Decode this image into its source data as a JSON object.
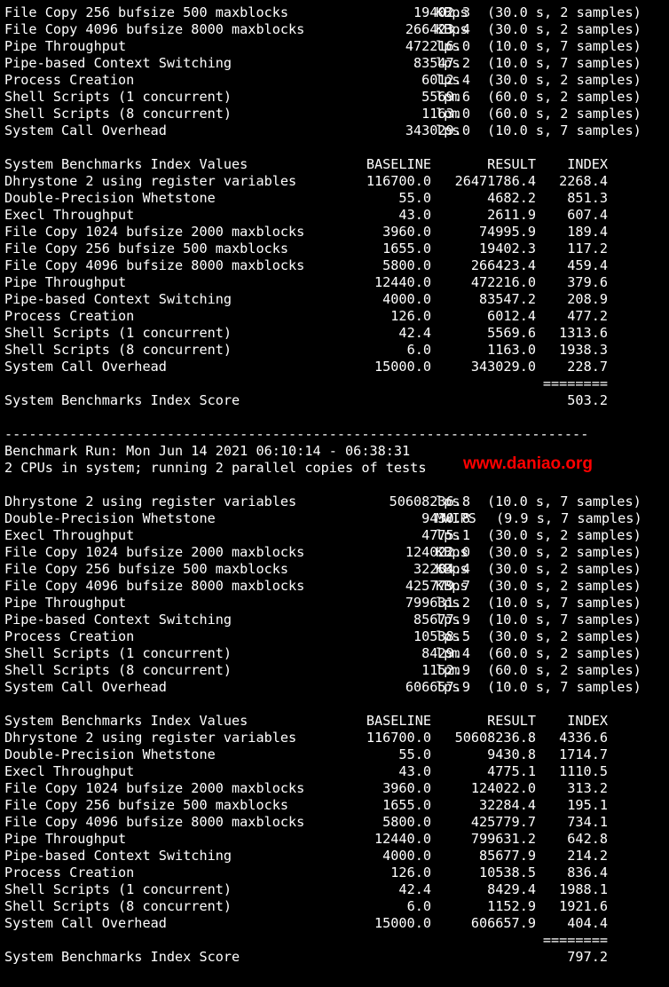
{
  "colors": {
    "background": "#000000",
    "text": "#ffffff",
    "watermark": "#ff0000"
  },
  "watermark": "www.daniao.org",
  "top_results": [
    {
      "name": "File Copy 256 bufsize 500 maxblocks",
      "value": "19402.3",
      "unit": "KBps",
      "detail": "(30.0 s, 2 samples)"
    },
    {
      "name": "File Copy 4096 bufsize 8000 maxblocks",
      "value": "266423.4",
      "unit": "KBps",
      "detail": "(30.0 s, 2 samples)"
    },
    {
      "name": "Pipe Throughput",
      "value": "472216.0",
      "unit": "lps",
      "detail": "(10.0 s, 7 samples)"
    },
    {
      "name": "Pipe-based Context Switching",
      "value": "83547.2",
      "unit": "lps",
      "detail": "(10.0 s, 7 samples)"
    },
    {
      "name": "Process Creation",
      "value": "6012.4",
      "unit": "lps",
      "detail": "(30.0 s, 2 samples)"
    },
    {
      "name": "Shell Scripts (1 concurrent)",
      "value": "5569.6",
      "unit": "lpm",
      "detail": "(60.0 s, 2 samples)"
    },
    {
      "name": "Shell Scripts (8 concurrent)",
      "value": "1163.0",
      "unit": "lpm",
      "detail": "(60.0 s, 2 samples)"
    },
    {
      "name": "System Call Overhead",
      "value": "343029.0",
      "unit": "lps",
      "detail": "(10.0 s, 7 samples)"
    }
  ],
  "index1": {
    "header": {
      "title": "System Benchmarks Index Values",
      "baseline": "BASELINE",
      "result": "RESULT",
      "index": "INDEX"
    },
    "rows": [
      {
        "name": "Dhrystone 2 using register variables",
        "baseline": "116700.0",
        "result": "26471786.4",
        "index": "2268.4"
      },
      {
        "name": "Double-Precision Whetstone",
        "baseline": "55.0",
        "result": "4682.2",
        "index": "851.3"
      },
      {
        "name": "Execl Throughput",
        "baseline": "43.0",
        "result": "2611.9",
        "index": "607.4"
      },
      {
        "name": "File Copy 1024 bufsize 2000 maxblocks",
        "baseline": "3960.0",
        "result": "74995.9",
        "index": "189.4"
      },
      {
        "name": "File Copy 256 bufsize 500 maxblocks",
        "baseline": "1655.0",
        "result": "19402.3",
        "index": "117.2"
      },
      {
        "name": "File Copy 4096 bufsize 8000 maxblocks",
        "baseline": "5800.0",
        "result": "266423.4",
        "index": "459.4"
      },
      {
        "name": "Pipe Throughput",
        "baseline": "12440.0",
        "result": "472216.0",
        "index": "379.6"
      },
      {
        "name": "Pipe-based Context Switching",
        "baseline": "4000.0",
        "result": "83547.2",
        "index": "208.9"
      },
      {
        "name": "Process Creation",
        "baseline": "126.0",
        "result": "6012.4",
        "index": "477.2"
      },
      {
        "name": "Shell Scripts (1 concurrent)",
        "baseline": "42.4",
        "result": "5569.6",
        "index": "1313.6"
      },
      {
        "name": "Shell Scripts (8 concurrent)",
        "baseline": "6.0",
        "result": "1163.0",
        "index": "1938.3"
      },
      {
        "name": "System Call Overhead",
        "baseline": "15000.0",
        "result": "343029.0",
        "index": "228.7"
      }
    ],
    "separator": "========",
    "score_label": "System Benchmarks Index Score",
    "score": "503.2"
  },
  "divider": "------------------------------------------------------------------------",
  "run": {
    "line": "Benchmark Run: Mon Jun 14 2021 06:10:14 - 06:38:31",
    "cpus": "2 CPUs in system; running 2 parallel copies of tests"
  },
  "results2": [
    {
      "name": "Dhrystone 2 using register variables",
      "value": "50608236.8",
      "unit": "lps",
      "detail": "(10.0 s, 7 samples)"
    },
    {
      "name": "Double-Precision Whetstone",
      "value": "9430.8",
      "unit": "MWIPS",
      "detail": "(9.9 s, 7 samples)"
    },
    {
      "name": "Execl Throughput",
      "value": "4775.1",
      "unit": "lps",
      "detail": "(30.0 s, 2 samples)"
    },
    {
      "name": "File Copy 1024 bufsize 2000 maxblocks",
      "value": "124022.0",
      "unit": "KBps",
      "detail": "(30.0 s, 2 samples)"
    },
    {
      "name": "File Copy 256 bufsize 500 maxblocks",
      "value": "32284.4",
      "unit": "KBps",
      "detail": "(30.0 s, 2 samples)"
    },
    {
      "name": "File Copy 4096 bufsize 8000 maxblocks",
      "value": "425779.7",
      "unit": "KBps",
      "detail": "(30.0 s, 2 samples)"
    },
    {
      "name": "Pipe Throughput",
      "value": "799631.2",
      "unit": "lps",
      "detail": "(10.0 s, 7 samples)"
    },
    {
      "name": "Pipe-based Context Switching",
      "value": "85677.9",
      "unit": "lps",
      "detail": "(10.0 s, 7 samples)"
    },
    {
      "name": "Process Creation",
      "value": "10538.5",
      "unit": "lps",
      "detail": "(30.0 s, 2 samples)"
    },
    {
      "name": "Shell Scripts (1 concurrent)",
      "value": "8429.4",
      "unit": "lpm",
      "detail": "(60.0 s, 2 samples)"
    },
    {
      "name": "Shell Scripts (8 concurrent)",
      "value": "1152.9",
      "unit": "lpm",
      "detail": "(60.0 s, 2 samples)"
    },
    {
      "name": "System Call Overhead",
      "value": "606657.9",
      "unit": "lps",
      "detail": "(10.0 s, 7 samples)"
    }
  ],
  "index2": {
    "header": {
      "title": "System Benchmarks Index Values",
      "baseline": "BASELINE",
      "result": "RESULT",
      "index": "INDEX"
    },
    "rows": [
      {
        "name": "Dhrystone 2 using register variables",
        "baseline": "116700.0",
        "result": "50608236.8",
        "index": "4336.6"
      },
      {
        "name": "Double-Precision Whetstone",
        "baseline": "55.0",
        "result": "9430.8",
        "index": "1714.7"
      },
      {
        "name": "Execl Throughput",
        "baseline": "43.0",
        "result": "4775.1",
        "index": "1110.5"
      },
      {
        "name": "File Copy 1024 bufsize 2000 maxblocks",
        "baseline": "3960.0",
        "result": "124022.0",
        "index": "313.2"
      },
      {
        "name": "File Copy 256 bufsize 500 maxblocks",
        "baseline": "1655.0",
        "result": "32284.4",
        "index": "195.1"
      },
      {
        "name": "File Copy 4096 bufsize 8000 maxblocks",
        "baseline": "5800.0",
        "result": "425779.7",
        "index": "734.1"
      },
      {
        "name": "Pipe Throughput",
        "baseline": "12440.0",
        "result": "799631.2",
        "index": "642.8"
      },
      {
        "name": "Pipe-based Context Switching",
        "baseline": "4000.0",
        "result": "85677.9",
        "index": "214.2"
      },
      {
        "name": "Process Creation",
        "baseline": "126.0",
        "result": "10538.5",
        "index": "836.4"
      },
      {
        "name": "Shell Scripts (1 concurrent)",
        "baseline": "42.4",
        "result": "8429.4",
        "index": "1988.1"
      },
      {
        "name": "Shell Scripts (8 concurrent)",
        "baseline": "6.0",
        "result": "1152.9",
        "index": "1921.6"
      },
      {
        "name": "System Call Overhead",
        "baseline": "15000.0",
        "result": "606657.9",
        "index": "404.4"
      }
    ],
    "separator": "========",
    "score_label": "System Benchmarks Index Score",
    "score": "797.2"
  }
}
